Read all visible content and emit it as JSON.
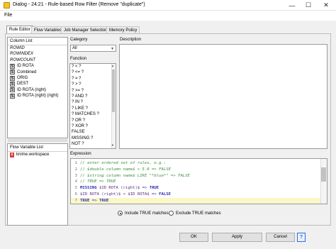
{
  "window": {
    "title": "Dialog - 24:21 - Rule-based Row Filter (Remove \"duplicate\")",
    "min_icon": "minimize-icon",
    "max_icon": "maximize-icon",
    "close_icon": "close-icon"
  },
  "menu": {
    "file": "File"
  },
  "tabs": [
    {
      "label": "Rule Editor",
      "active": true
    },
    {
      "label": "Flow Variables"
    },
    {
      "label": "Job Manager Selection"
    },
    {
      "label": "Memory Policy"
    }
  ],
  "column_list": {
    "title": "Column List",
    "items": [
      {
        "label": "ROWID",
        "type": "special"
      },
      {
        "label": "ROWINDEX",
        "type": "special"
      },
      {
        "label": "ROWCOUNT",
        "type": "special"
      },
      {
        "label": "ID ROTA",
        "type": "string"
      },
      {
        "label": "Combined",
        "type": "string"
      },
      {
        "label": "ORIG",
        "type": "string"
      },
      {
        "label": "DEST",
        "type": "string"
      },
      {
        "label": "ID ROTA (right)",
        "type": "string"
      },
      {
        "label": "ID ROTA (right) (right)",
        "type": "string"
      }
    ],
    "type_badge": "S"
  },
  "flow_variable_list": {
    "title": "Flow Variable List",
    "items": [
      {
        "label": "knime.workspace",
        "type_badge": "s"
      }
    ]
  },
  "category": {
    "label": "Category",
    "value": "All"
  },
  "function": {
    "label": "Function",
    "items": [
      "? < ?",
      "? <= ?",
      "? = ?",
      "? > ?",
      "? >= ?",
      "? AND ?",
      "? IN ?",
      "? LIKE ?",
      "? MATCHES ?",
      "? OR ?",
      "? XOR ?",
      "FALSE",
      "MISSING ?",
      "NOT ?"
    ]
  },
  "description": {
    "label": "Description"
  },
  "expression": {
    "label": "Expression",
    "lines": [
      {
        "n": "1",
        "text": "// enter ordered set of rules, e.g.:"
      },
      {
        "n": "2",
        "text": "// $double column name$ > 5.0 => FALSE"
      },
      {
        "n": "3",
        "text": "// $string column name$ LIKE \"*blue*\" => FALSE"
      },
      {
        "n": "4",
        "text": "// TRUE => TRUE"
      },
      {
        "n": "5",
        "kw": "MISSING",
        "rest_a": " $ID ROTA (right)$ ",
        "arrow": "=>",
        "kw2": " TRUE"
      },
      {
        "n": "6",
        "rest_a": "$ID ROTA (right)$ < $ID ROTA$ ",
        "arrow": "=>",
        "kw2": " FALSE"
      },
      {
        "n": "7",
        "kw": "TRUE",
        "rest_a": " ",
        "arrow": "=>",
        "kw2": " TRUE"
      }
    ]
  },
  "filter_mode": {
    "include_label": "Include TRUE matches",
    "exclude_label": "Exclude TRUE matches",
    "selected": "include"
  },
  "buttons": {
    "ok": "OK",
    "apply": "Apply",
    "cancel": "Cancel",
    "help": "?"
  }
}
